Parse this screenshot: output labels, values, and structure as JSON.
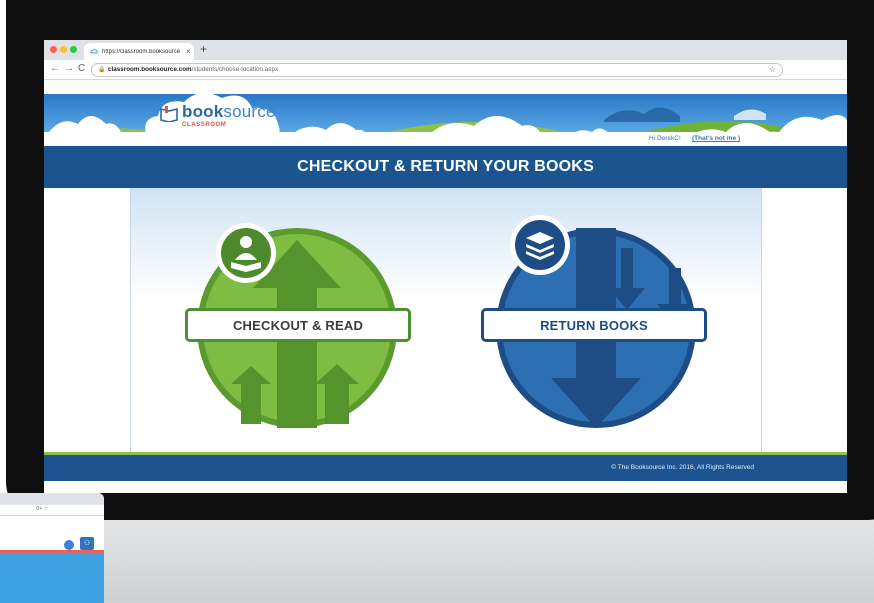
{
  "browser": {
    "tab_title": "https://classroom.booksource",
    "tab_close": "×",
    "new_tab": "+",
    "url_host": "classroom.booksource.com",
    "url_path": "/students/choose-location.aspx",
    "nav_back": "←",
    "nav_forward": "→",
    "nav_reload": "C",
    "lock_icon": "🔒",
    "bookmark_star": "☆"
  },
  "site": {
    "logo_primary": "book",
    "logo_secondary": "source",
    "logo_sub": "CLASSROOM",
    "greeting": "Hi DerekC!",
    "not_me_link": "(That's not me )",
    "page_title": "CHECKOUT & RETURN YOUR BOOKS",
    "copyright": "© The Booksource Inc. 2016, All Rights Reserved"
  },
  "choices": {
    "checkout_label": "CHECKOUT & READ",
    "return_label": "RETURN BOOKS"
  },
  "laptop": {
    "mini_icons": "0+ ☆"
  },
  "colors": {
    "brand_blue": "#1b548f",
    "checkout_green": "#7fbc42",
    "return_blue": "#2d6fb3",
    "accent_green": "#8fc14a"
  }
}
